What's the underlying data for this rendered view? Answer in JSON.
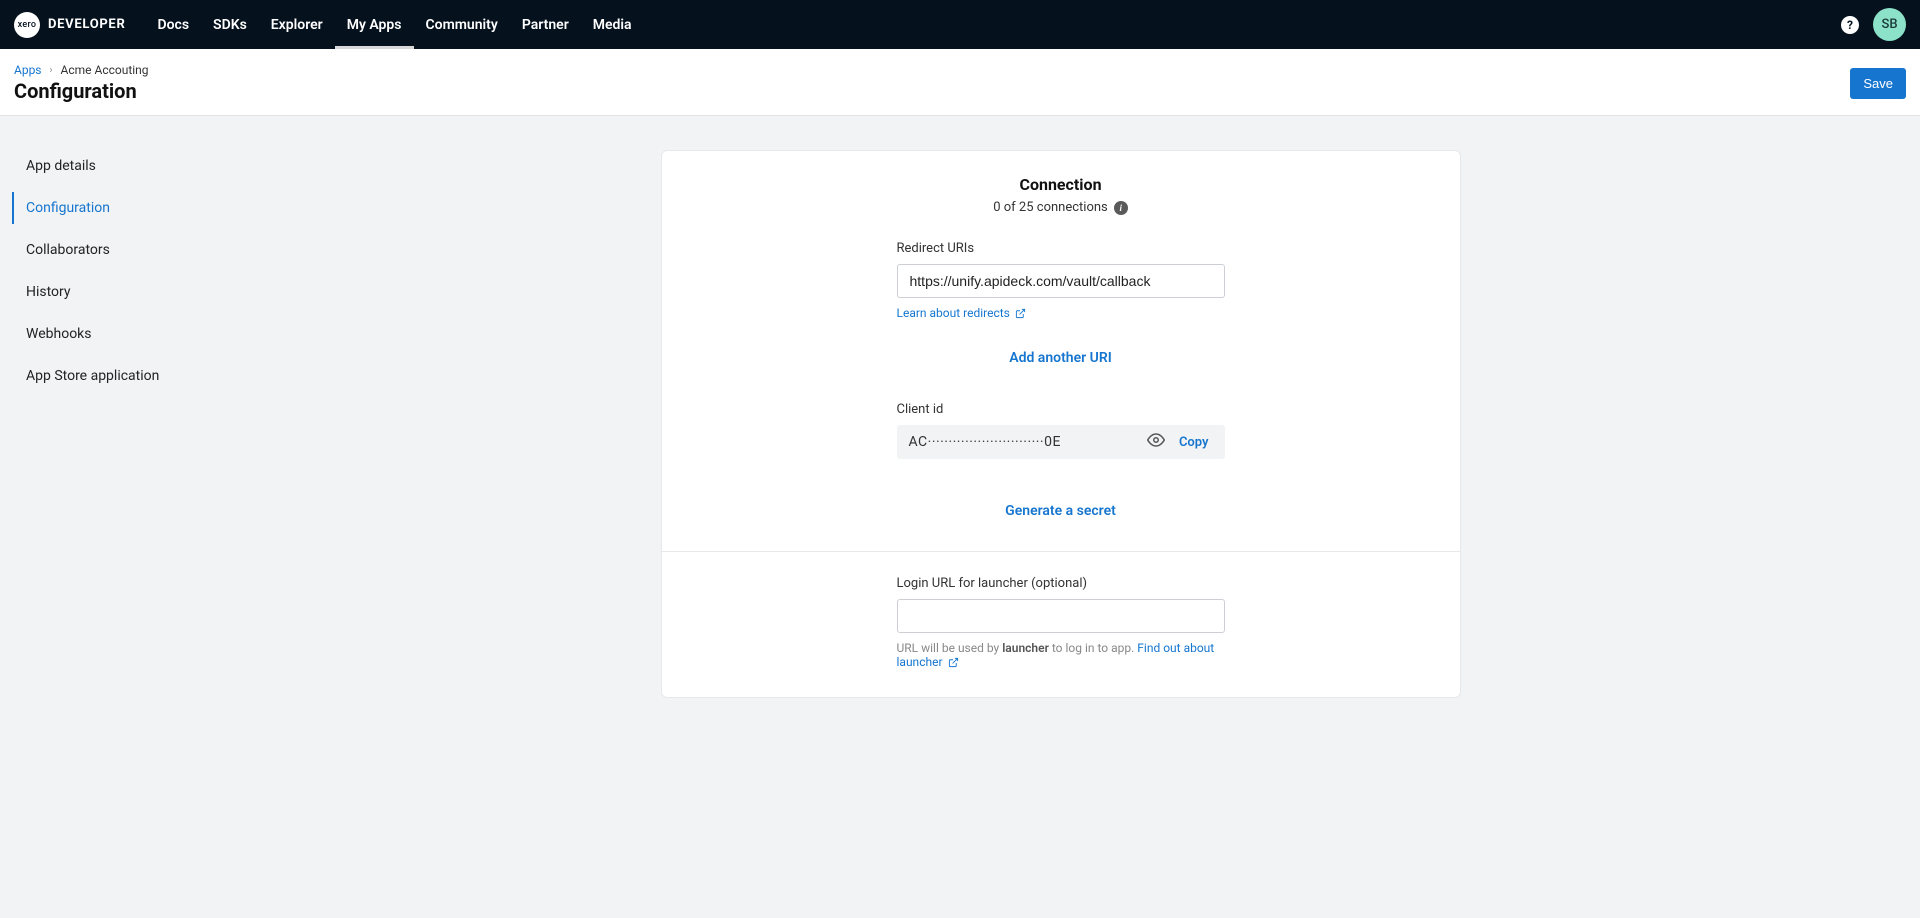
{
  "nav": {
    "logo_brand": "xero",
    "logo_word": "DEVELOPER",
    "items": [
      {
        "label": "Docs",
        "active": false
      },
      {
        "label": "SDKs",
        "active": false
      },
      {
        "label": "Explorer",
        "active": false
      },
      {
        "label": "My Apps",
        "active": true
      },
      {
        "label": "Community",
        "active": false
      },
      {
        "label": "Partner",
        "active": false
      },
      {
        "label": "Media",
        "active": false
      }
    ],
    "help_glyph": "?",
    "avatar": "SB"
  },
  "breadcrumb": {
    "root": "Apps",
    "sep": "›",
    "current": "Acme Accouting"
  },
  "page_title": "Configuration",
  "save_btn": "Save",
  "sidebar": {
    "items": [
      {
        "label": "App details",
        "active": false
      },
      {
        "label": "Configuration",
        "active": true
      },
      {
        "label": "Collaborators",
        "active": false
      },
      {
        "label": "History",
        "active": false
      },
      {
        "label": "Webhooks",
        "active": false
      },
      {
        "label": "App Store application",
        "active": false
      }
    ]
  },
  "connection": {
    "title": "Connection",
    "subtitle": "0 of 25 connections",
    "redirect_label": "Redirect URIs",
    "redirect_value": "https://unify.apideck.com/vault/callback",
    "redirect_help": "Learn about redirects",
    "add_uri": "Add another URI",
    "client_id_label": "Client id",
    "client_id_value": "AC····························0E",
    "copy_label": "Copy",
    "gen_secret": "Generate a secret"
  },
  "launcher": {
    "label": "Login URL for launcher (optional)",
    "value": "",
    "helper_prefix": "URL will be used by ",
    "helper_bold": "launcher",
    "helper_suffix": " to log in to app. ",
    "helper_link": "Find out about launcher"
  }
}
